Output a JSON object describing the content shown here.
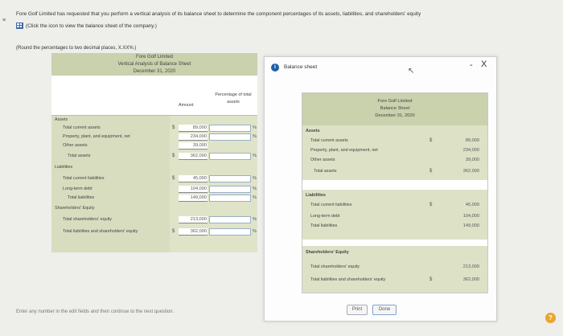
{
  "instructions": {
    "line1": "Fore Golf Limited has requested that you perform a vertical analysis of its balance sheet to determine the component percentages of its assets, liabilities, and shareholders' equity",
    "line2": "(Click the icon to view the balance sheet of the company.)",
    "rounding_note": "(Round the percentages to two decimal places, X.XX%.)"
  },
  "worksheet": {
    "company": "Fore Golf Limited",
    "title": "Vertical Analysis of Balance Sheet",
    "date": "December 31, 2020",
    "col_amount": "Amount",
    "col_pct": "Percentage of total assets",
    "rows": [
      {
        "label": "Assets",
        "amount": "",
        "dollar": "",
        "pct": false
      },
      {
        "label": "Total current assets",
        "amount": "89,000",
        "dollar": "$",
        "pct": true
      },
      {
        "label": "Property, plant, and equipment, net",
        "amount": "234,000",
        "dollar": "",
        "pct": true
      },
      {
        "label": "Other assets",
        "amount": "39,000",
        "dollar": "",
        "pct": false
      },
      {
        "label": "Total assets",
        "amount": "362,000",
        "dollar": "$",
        "pct": true
      },
      {
        "label": "Liabilities",
        "amount": "",
        "dollar": "",
        "pct": false
      },
      {
        "label": "Total current liabilities",
        "amount": "45,000",
        "dollar": "$",
        "pct": true
      },
      {
        "label": "Long-term debt",
        "amount": "104,000",
        "dollar": "",
        "pct": true
      },
      {
        "label": "Total liabilities",
        "amount": "149,000",
        "dollar": "",
        "pct": true
      },
      {
        "label": "Shareholders' Equity",
        "amount": "",
        "dollar": "",
        "pct": false
      },
      {
        "label": "Total shareholders' equity",
        "amount": "213,000",
        "dollar": "",
        "pct": true
      },
      {
        "label": "Total liabilities and shareholders' equity",
        "amount": "362,000",
        "dollar": "$",
        "pct": true
      }
    ],
    "pct_symbol": "%"
  },
  "modal": {
    "title": "Balance sheet",
    "minimize": "-",
    "close": "X",
    "sheet": {
      "company": "Fore Golf Limited",
      "title": "Balance Sheet",
      "date": "December 31, 2020",
      "assets_header": "Assets",
      "assets": [
        {
          "label": "Total current assets",
          "dollar": "$",
          "amount": "89,000"
        },
        {
          "label": "Property, plant, and equipment, net",
          "dollar": "",
          "amount": "234,000"
        },
        {
          "label": "Other assets",
          "dollar": "",
          "amount": "39,000"
        },
        {
          "label": "Total assets",
          "dollar": "$",
          "amount": "362,000"
        }
      ],
      "liabilities_header": "Liabilities",
      "liabilities": [
        {
          "label": "Total current liabilities",
          "dollar": "$",
          "amount": "45,000"
        },
        {
          "label": "Long-term debt",
          "dollar": "",
          "amount": "104,000"
        },
        {
          "label": "Total liabilities",
          "dollar": "",
          "amount": "149,000"
        }
      ],
      "equity_header": "Shareholders' Equity",
      "equity": [
        {
          "label": "Total shareholders' equity",
          "dollar": "",
          "amount": "213,000"
        },
        {
          "label": "Total liabilities and shareholders' equity",
          "dollar": "$",
          "amount": "362,000"
        }
      ]
    },
    "print_label": "Print",
    "done_label": "Done"
  },
  "footer": "Enter any number in the edit fields and then continue to the next question.",
  "help": "?"
}
